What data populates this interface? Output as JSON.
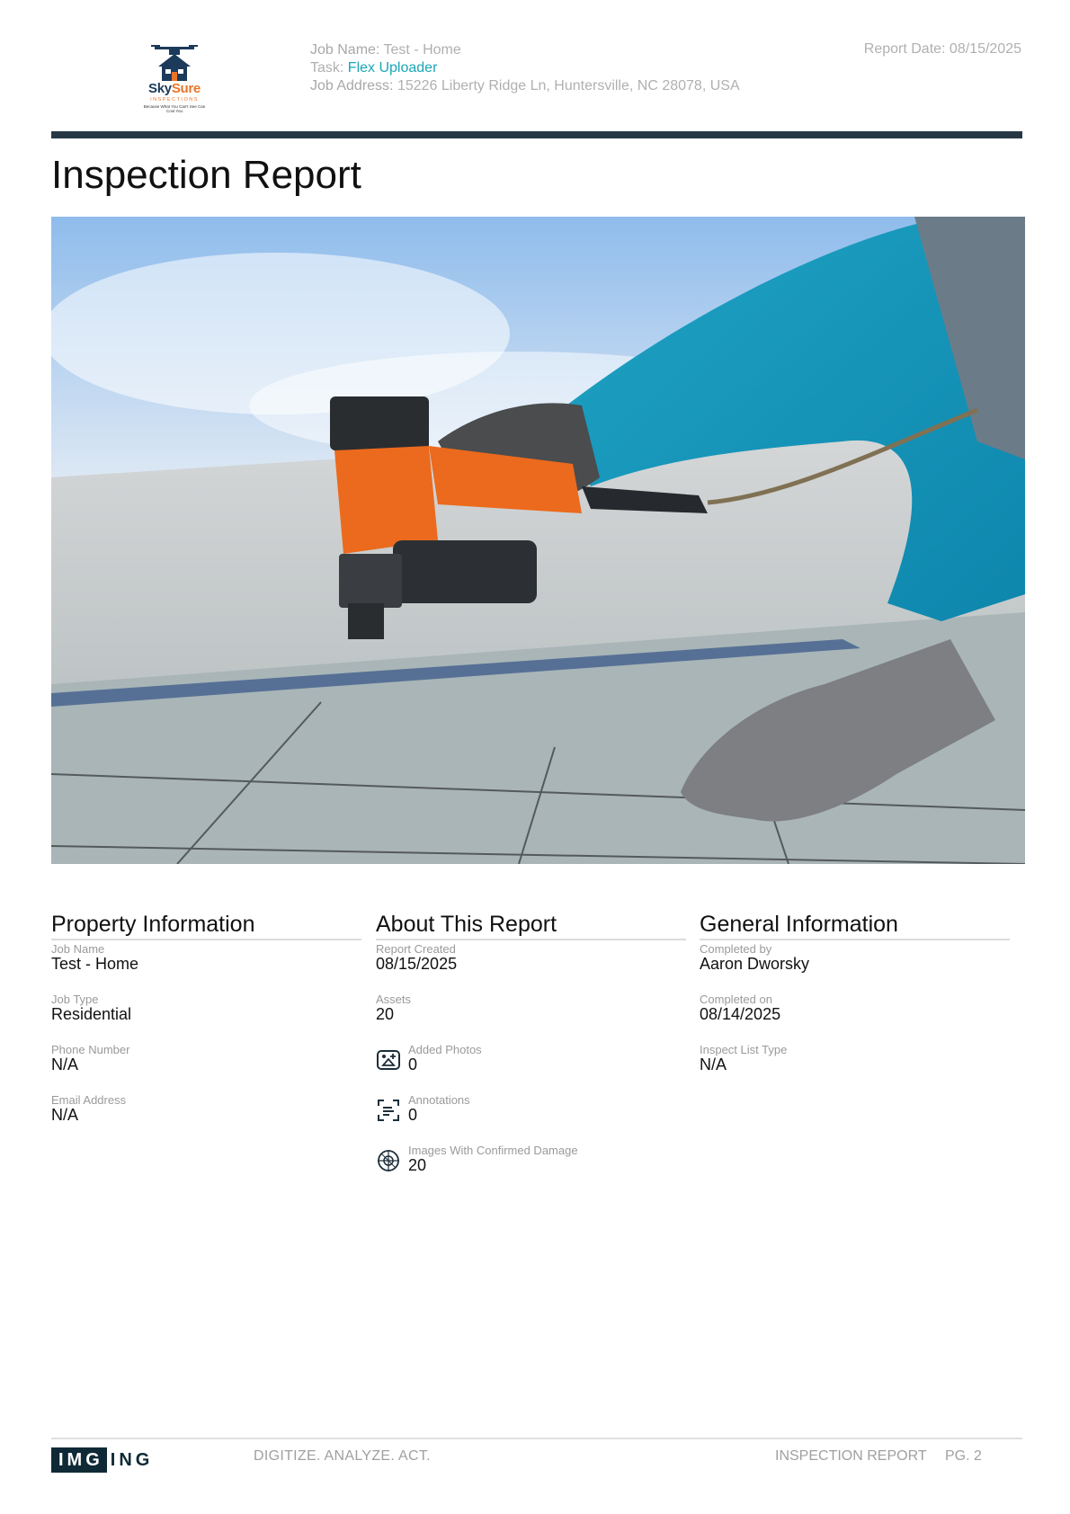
{
  "header": {
    "logo": {
      "brand_part1": "Sky",
      "brand_part2": "Sure",
      "sub": "INSPECTIONS",
      "tagline": "Because What You Can't See Can Cost You"
    },
    "job_name_label": "Job Name:",
    "job_name_value": "Test - Home",
    "task_label": "Task:",
    "task_value": "Flex Uploader",
    "job_address_label": "Job Address:",
    "job_address_value": "15226 Liberty Ridge Ln, Huntersville, NC 28078, USA",
    "report_date": "Report Date: 08/15/2025"
  },
  "title": "Inspection Report",
  "hero": {
    "icon": "roofer-nail-gun-photo"
  },
  "property_information": {
    "heading": "Property Information",
    "fields": [
      {
        "label": "Job Name",
        "value": "Test - Home"
      },
      {
        "label": "Job Type",
        "value": "Residential"
      },
      {
        "label": "Phone Number",
        "value": "N/A"
      },
      {
        "label": "Email Address",
        "value": "N/A"
      }
    ]
  },
  "about_this_report": {
    "heading": "About This Report",
    "fields": [
      {
        "label": "Report Created",
        "value": "08/15/2025"
      },
      {
        "label": "Assets",
        "value": "20"
      },
      {
        "label": "Added Photos",
        "value": "0",
        "icon": "add-photo-icon"
      },
      {
        "label": "Annotations",
        "value": "0",
        "icon": "annotation-icon"
      },
      {
        "label": "Images With Confirmed Damage",
        "value": "20",
        "icon": "damage-target-icon"
      }
    ]
  },
  "general_information": {
    "heading": "General Information",
    "fields": [
      {
        "label": "Completed by",
        "value": "Aaron Dworsky"
      },
      {
        "label": "Completed on",
        "value": "08/14/2025"
      },
      {
        "label": "Inspect List Type",
        "value": "N/A"
      }
    ]
  },
  "footer": {
    "logo_box": "IMG",
    "logo_rest": "ING",
    "tagline": "DIGITIZE. ANALYZE. ACT.",
    "report_label": "INSPECTION REPORT",
    "page": "PG. 2"
  },
  "colors": {
    "accent": "#1aa6b7",
    "bar": "#263845",
    "logo_orange": "#e8752a",
    "logo_navy": "#1c3b5a"
  }
}
